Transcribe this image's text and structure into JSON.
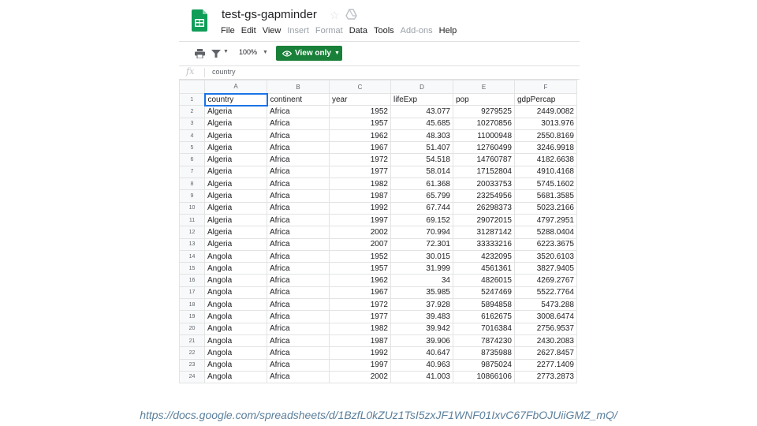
{
  "doc": {
    "title": "test-gs-gapminder"
  },
  "menu": [
    {
      "label": "File",
      "disabled": false
    },
    {
      "label": "Edit",
      "disabled": false
    },
    {
      "label": "View",
      "disabled": false
    },
    {
      "label": "Insert",
      "disabled": true
    },
    {
      "label": "Format",
      "disabled": true
    },
    {
      "label": "Data",
      "disabled": false
    },
    {
      "label": "Tools",
      "disabled": false
    },
    {
      "label": "Add-ons",
      "disabled": true
    },
    {
      "label": "Help",
      "disabled": false
    }
  ],
  "toolbar": {
    "zoom": "100%",
    "view_label": "View only",
    "view_color": "#188038"
  },
  "formula": {
    "fx": "fx",
    "value": "country"
  },
  "grid": {
    "columns": [
      "A",
      "B",
      "C",
      "D",
      "E",
      "F"
    ],
    "header_row": [
      "country",
      "continent",
      "year",
      "lifeExp",
      "pop",
      "gdpPercap"
    ],
    "rows": [
      [
        "Algeria",
        "Africa",
        "1952",
        "43.077",
        "9279525",
        "2449.0082"
      ],
      [
        "Algeria",
        "Africa",
        "1957",
        "45.685",
        "10270856",
        "3013.976"
      ],
      [
        "Algeria",
        "Africa",
        "1962",
        "48.303",
        "11000948",
        "2550.8169"
      ],
      [
        "Algeria",
        "Africa",
        "1967",
        "51.407",
        "12760499",
        "3246.9918"
      ],
      [
        "Algeria",
        "Africa",
        "1972",
        "54.518",
        "14760787",
        "4182.6638"
      ],
      [
        "Algeria",
        "Africa",
        "1977",
        "58.014",
        "17152804",
        "4910.4168"
      ],
      [
        "Algeria",
        "Africa",
        "1982",
        "61.368",
        "20033753",
        "5745.1602"
      ],
      [
        "Algeria",
        "Africa",
        "1987",
        "65.799",
        "23254956",
        "5681.3585"
      ],
      [
        "Algeria",
        "Africa",
        "1992",
        "67.744",
        "26298373",
        "5023.2166"
      ],
      [
        "Algeria",
        "Africa",
        "1997",
        "69.152",
        "29072015",
        "4797.2951"
      ],
      [
        "Algeria",
        "Africa",
        "2002",
        "70.994",
        "31287142",
        "5288.0404"
      ],
      [
        "Algeria",
        "Africa",
        "2007",
        "72.301",
        "33333216",
        "6223.3675"
      ],
      [
        "Angola",
        "Africa",
        "1952",
        "30.015",
        "4232095",
        "3520.6103"
      ],
      [
        "Angola",
        "Africa",
        "1957",
        "31.999",
        "4561361",
        "3827.9405"
      ],
      [
        "Angola",
        "Africa",
        "1962",
        "34",
        "4826015",
        "4269.2767"
      ],
      [
        "Angola",
        "Africa",
        "1967",
        "35.985",
        "5247469",
        "5522.7764"
      ],
      [
        "Angola",
        "Africa",
        "1972",
        "37.928",
        "5894858",
        "5473.288"
      ],
      [
        "Angola",
        "Africa",
        "1977",
        "39.483",
        "6162675",
        "3008.6474"
      ],
      [
        "Angola",
        "Africa",
        "1982",
        "39.942",
        "7016384",
        "2756.9537"
      ],
      [
        "Angola",
        "Africa",
        "1987",
        "39.906",
        "7874230",
        "2430.2083"
      ],
      [
        "Angola",
        "Africa",
        "1992",
        "40.647",
        "8735988",
        "2627.8457"
      ],
      [
        "Angola",
        "Africa",
        "1997",
        "40.963",
        "9875024",
        "2277.1409"
      ],
      [
        "Angola",
        "Africa",
        "2002",
        "41.003",
        "10866106",
        "2773.2873"
      ]
    ]
  },
  "footer": {
    "url": "https://docs.google.com/spreadsheets/d/1BzfL0kZUz1TsI5zxJF1WNF01IxvC67FbOJUiiGMZ_mQ/"
  }
}
